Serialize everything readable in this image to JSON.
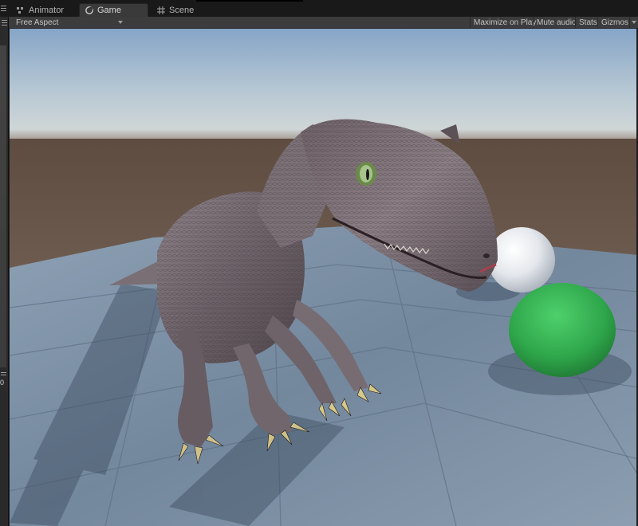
{
  "tabs": [
    {
      "label": "Animator",
      "icon": "animator-icon",
      "active": false
    },
    {
      "label": "Game",
      "icon": "game-controller-icon",
      "active": true
    },
    {
      "label": "Scene",
      "icon": "scene-grid-icon",
      "active": false
    }
  ],
  "toolbar": {
    "aspect": "Free Aspect",
    "maximize_on_play": "Maximize on Play",
    "mute_audio": "Mute audio",
    "stats": "Stats",
    "gizmos": "Gizmos"
  },
  "left_panel": {
    "number": "0"
  },
  "scene": {
    "sky_top": "#87a6c7",
    "sky_horizon": "#c8d4dc",
    "ground_color": "#5b4b41",
    "floor_color": "#7d8fa3",
    "sphere_white": "#eef0f4",
    "sphere_green": "#2fae4d",
    "dino_color": "#6f6469"
  }
}
